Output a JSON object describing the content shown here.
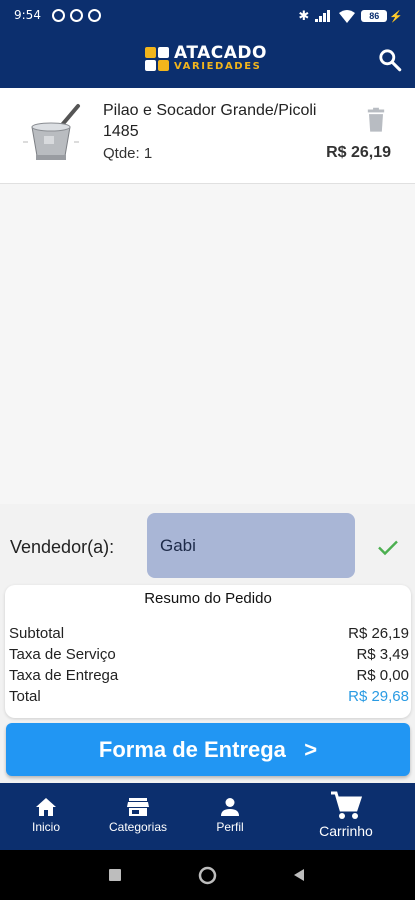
{
  "status_bar": {
    "time": "9:54",
    "battery": "86"
  },
  "header": {
    "brand_line1": "ATACADO",
    "brand_line2": "VARIEDADES",
    "search_icon": "search-icon"
  },
  "cart": {
    "items": [
      {
        "name": "Pilao e Socador Grande/Picoli 1485",
        "qty_label": "Qtde: 1",
        "price": "R$ 26,19"
      }
    ]
  },
  "seller": {
    "label": "Vendedor(a):",
    "value": "Gabi"
  },
  "summary": {
    "title": "Resumo do Pedido",
    "rows": [
      {
        "label": "Subtotal",
        "value": "R$ 26,19"
      },
      {
        "label": "Taxa de Serviço",
        "value": "R$ 3,49"
      },
      {
        "label": "Taxa de Entrega",
        "value": "R$ 0,00"
      },
      {
        "label": "Total",
        "value": "R$ 29,68"
      }
    ]
  },
  "delivery_button": "Forma de Entrega   >",
  "bottom_nav": [
    {
      "label": "Inicio",
      "icon": "home-icon"
    },
    {
      "label": "Categorias",
      "icon": "store-icon"
    },
    {
      "label": "Perfil",
      "icon": "person-icon"
    },
    {
      "label": "Carrinho",
      "icon": "cart-icon"
    }
  ],
  "colors": {
    "primary": "#0c2f6e",
    "accent": "#2196f3",
    "brand_yellow": "#f2b51c",
    "total": "#2a9be3",
    "check": "#4caf50"
  }
}
